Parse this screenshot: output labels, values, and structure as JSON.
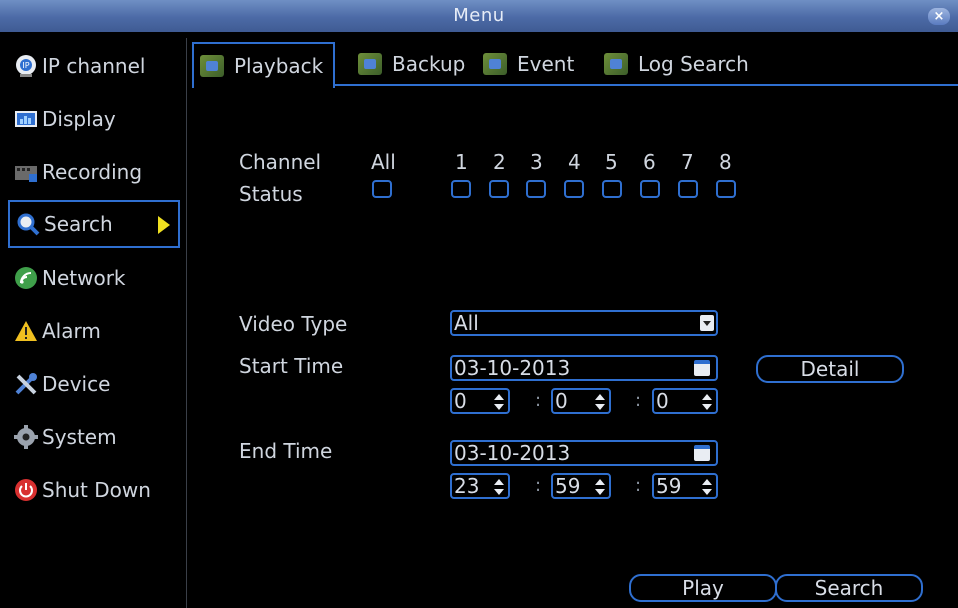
{
  "window": {
    "title": "Menu",
    "close_label": "×"
  },
  "sidebar": {
    "items": [
      {
        "label": "IP channel",
        "icon": "ip-camera-icon"
      },
      {
        "label": "Display",
        "icon": "display-icon"
      },
      {
        "label": "Recording",
        "icon": "recording-icon"
      },
      {
        "label": "Search",
        "icon": "search-icon",
        "selected": true
      },
      {
        "label": "Network",
        "icon": "network-icon"
      },
      {
        "label": "Alarm",
        "icon": "alarm-icon"
      },
      {
        "label": "Device",
        "icon": "device-icon"
      },
      {
        "label": "System",
        "icon": "system-icon"
      },
      {
        "label": "Shut Down",
        "icon": "power-icon"
      }
    ]
  },
  "tabs": [
    {
      "label": "Playback",
      "active": true
    },
    {
      "label": "Backup"
    },
    {
      "label": "Event"
    },
    {
      "label": "Log Search"
    }
  ],
  "channel": {
    "label": "Channel",
    "status_label": "Status",
    "all_label": "All",
    "numbers": [
      "1",
      "2",
      "3",
      "4",
      "5",
      "6",
      "7",
      "8"
    ]
  },
  "video_type": {
    "label": "Video Type",
    "value": "All"
  },
  "start_time": {
    "label": "Start Time",
    "date": "03-10-2013",
    "hour": "0",
    "minute": "0",
    "second": "0",
    "detail_label": "Detail"
  },
  "end_time": {
    "label": "End Time",
    "date": "03-10-2013",
    "hour": "23",
    "minute": "59",
    "second": "59"
  },
  "colon": ":",
  "buttons": {
    "play": "Play",
    "search": "Search"
  },
  "colors": {
    "accent": "#2f6fd0",
    "titlebar": "#4c6aa6",
    "arrow": "#f0e020"
  }
}
